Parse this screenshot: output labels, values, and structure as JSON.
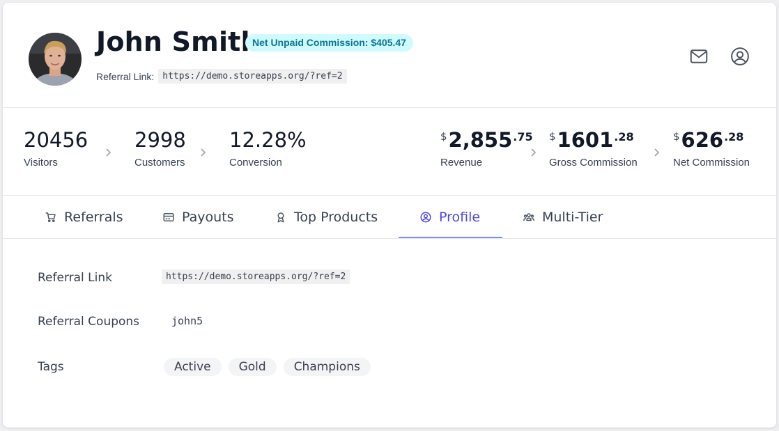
{
  "header": {
    "name": "John Smith",
    "badge": "Net Unpaid Commission: $405.47",
    "referral_label": "Referral Link:",
    "referral_link": "https://demo.storeapps.org/?ref=2"
  },
  "stats": {
    "visitors": {
      "value": "20456",
      "label": "Visitors"
    },
    "customers": {
      "value": "2998",
      "label": "Customers"
    },
    "conversion": {
      "value": "12.28%",
      "label": "Conversion"
    },
    "revenue": {
      "currency": "$",
      "whole": "2,855",
      "cents": ".75",
      "label": "Revenue"
    },
    "gross": {
      "currency": "$",
      "whole": "1601",
      "cents": ".28",
      "label": "Gross Commission"
    },
    "net": {
      "currency": "$",
      "whole": "626",
      "cents": ".28",
      "label": "Net Commission"
    }
  },
  "tabs": [
    {
      "label": "Referrals",
      "icon": "cart-icon"
    },
    {
      "label": "Payouts",
      "icon": "credit-card-icon"
    },
    {
      "label": "Top Products",
      "icon": "award-icon"
    },
    {
      "label": "Profile",
      "icon": "user-circle-icon"
    },
    {
      "label": "Multi-Tier",
      "icon": "users-icon"
    }
  ],
  "active_tab": "Profile",
  "profile": {
    "referral_link_label": "Referral Link",
    "referral_link": "https://demo.storeapps.org/?ref=2",
    "coupons_label": "Referral Coupons",
    "coupon": "john5",
    "tags_label": "Tags",
    "tags": [
      "Active",
      "Gold",
      "Champions"
    ]
  },
  "colors": {
    "accent": "#4f46e5",
    "badge_bg": "#cffafe",
    "badge_text": "#0e7490"
  }
}
